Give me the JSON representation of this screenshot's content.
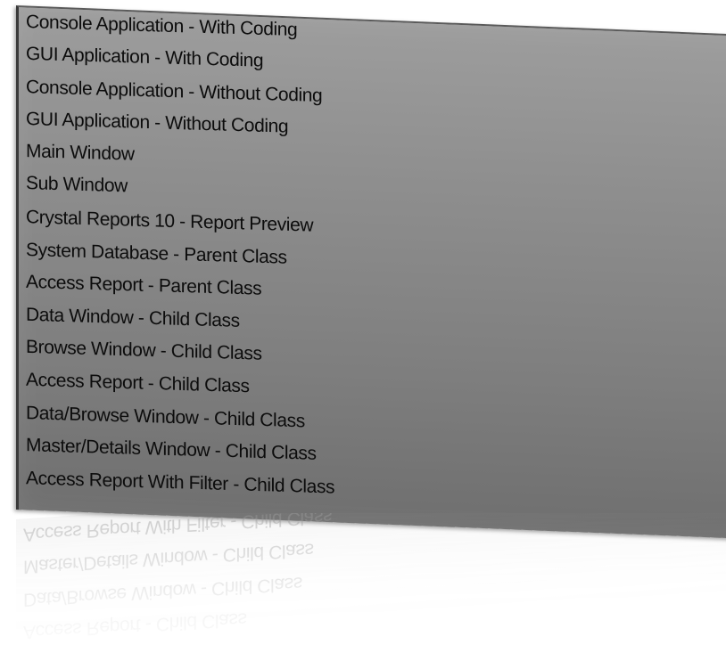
{
  "menu": {
    "items": [
      {
        "label": "Console Application - With Coding"
      },
      {
        "label": "GUI Application - With Coding"
      },
      {
        "label": "Console Application - Without Coding"
      },
      {
        "label": "GUI Application - Without Coding"
      },
      {
        "label": "Main Window"
      },
      {
        "label": "Sub Window"
      },
      {
        "label": "Crystal Reports 10 - Report Preview"
      },
      {
        "label": "System Database - Parent Class"
      },
      {
        "label": "Access Report - Parent Class"
      },
      {
        "label": "Data Window - Child Class"
      },
      {
        "label": "Browse Window - Child Class"
      },
      {
        "label": "Access Report - Child Class"
      },
      {
        "label": "Data/Browse Window - Child Class"
      },
      {
        "label": "Master/Details Window - Child Class"
      },
      {
        "label": "Access Report With Filter - Child Class"
      }
    ]
  },
  "colors": {
    "panel_light": "#9d9d9d",
    "panel_dark": "#6f6f6f",
    "text": "#0c0c0c",
    "border": "#3a3a3a"
  }
}
